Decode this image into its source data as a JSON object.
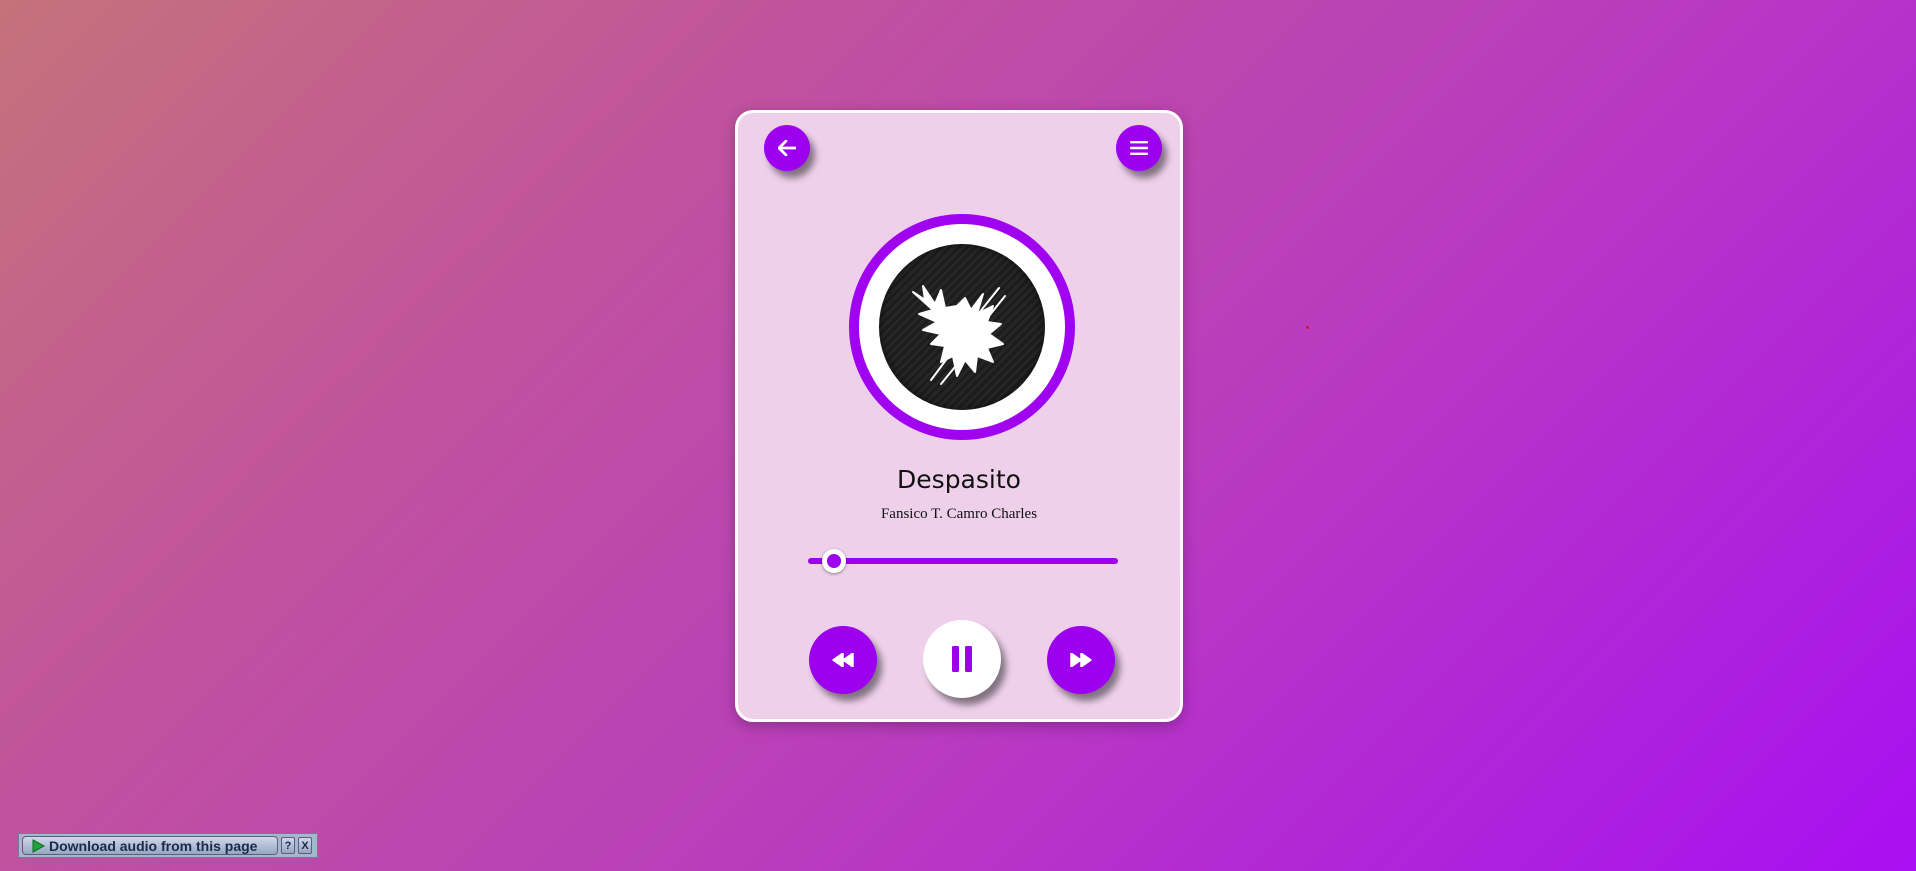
{
  "player": {
    "song_title": "Despasito",
    "artist": "Fansico T. Camro Charles",
    "progress_fraction": 0.06,
    "buttons": {
      "back_icon": "arrow-left-icon",
      "menu_icon": "hamburger-menu-icon",
      "prev_icon": "backward-icon",
      "play_pause_icon": "pause-icon",
      "next_icon": "forward-icon"
    },
    "colors": {
      "accent": "#9c00ee",
      "card": "#eed0ea",
      "white": "#ffffff"
    }
  },
  "download_bar": {
    "label": "Download audio from this page",
    "help_label": "?",
    "close_label": "X"
  }
}
